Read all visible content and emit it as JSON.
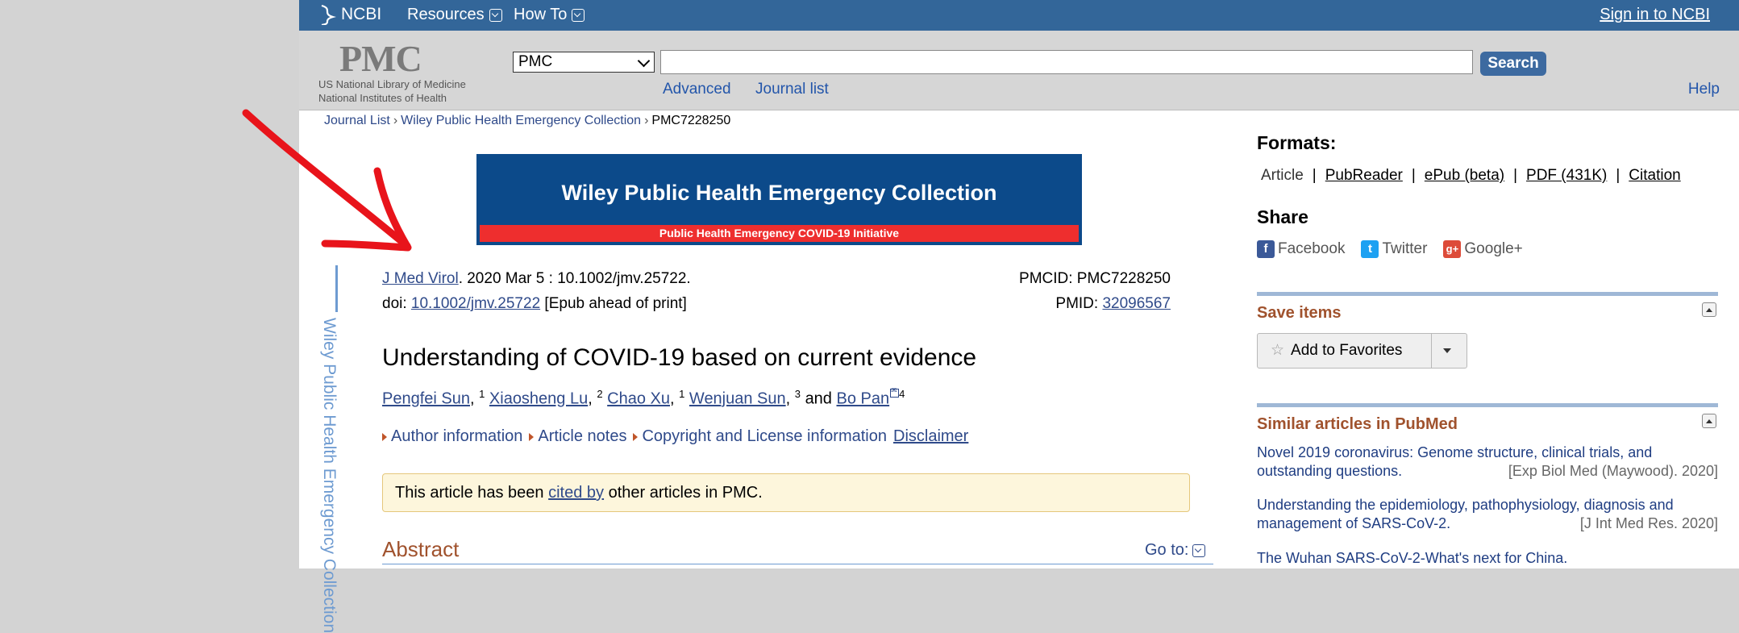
{
  "ncbi": {
    "logo": "NCBI",
    "nav": [
      {
        "label": "Resources"
      },
      {
        "label": "How To"
      }
    ],
    "signin": "Sign in to NCBI"
  },
  "pmc": {
    "logo": "PMC",
    "sub1": "US National Library of Medicine",
    "sub2": "National Institutes of Health",
    "db_selected": "PMC",
    "search_value": "",
    "search_button": "Search",
    "advanced": "Advanced",
    "journal_list": "Journal list",
    "help": "Help"
  },
  "breadcrumb": {
    "items": [
      "Journal List",
      "Wiley Public Health Emergency Collection"
    ],
    "current": "PMC7228250",
    "separator": "›"
  },
  "banner": {
    "title": "Wiley Public Health Emergency Collection",
    "strip": "Public Health Emergency COVID-19 Initiative"
  },
  "side_label": "Wiley Public Health Emergency Collection",
  "citation": {
    "journal": "J Med Virol",
    "line1_rest": ". 2020 Mar 5 : 10.1002/jmv.25722.",
    "doi_prefix": "doi: ",
    "doi": "10.1002/jmv.25722",
    "doi_suffix": " [Epub ahead of print]",
    "pmcid": "PMCID: PMC7228250",
    "pmid_label": "PMID: ",
    "pmid": "32096567"
  },
  "article": {
    "title": "Understanding of COVID-19 based on current evidence",
    "authors": [
      {
        "name": "Pengfei Sun",
        "sup": "1"
      },
      {
        "name": "Xiaosheng Lu",
        "sup": "2"
      },
      {
        "name": "Chao Xu",
        "sup": "1"
      },
      {
        "name": "Wenjuan Sun",
        "sup": "3"
      },
      {
        "name": "Bo Pan",
        "sup": "4"
      }
    ],
    "and": "and",
    "info_links": [
      "Author information",
      "Article notes",
      "Copyright and License information"
    ],
    "disclaimer": "Disclaimer",
    "cited_pre": "This article has been ",
    "cited_link": "cited by",
    "cited_post": " other articles in PMC.",
    "abstract": "Abstract",
    "goto": "Go to:"
  },
  "sidebar": {
    "formats_title": "Formats:",
    "formats": [
      "Article",
      "PubReader",
      "ePub (beta)",
      "PDF (431K)",
      "Citation"
    ],
    "share_title": "Share",
    "share": [
      {
        "label": "Facebook",
        "icon": "facebook-icon",
        "color": "#3b5998"
      },
      {
        "label": "Twitter",
        "icon": "twitter-icon",
        "color": "#1da1f2"
      },
      {
        "label": "Google+",
        "icon": "google-plus-icon",
        "color": "#dd4b39"
      }
    ],
    "save_title": "Save items",
    "add_favorites": "Add to Favorites",
    "similar_title": "Similar articles in PubMed",
    "similar": [
      {
        "title": "Novel 2019 coronavirus: Genome structure, clinical trials, and outstanding questions.",
        "source": "[Exp Biol Med (Maywood). 2020]"
      },
      {
        "title": "Understanding the epidemiology, pathophysiology, diagnosis and management of SARS-CoV-2.",
        "source": "[J Int Med Res. 2020]"
      },
      {
        "title": "The Wuhan SARS-CoV-2-What's next for China.",
        "source": ""
      }
    ]
  },
  "colors": {
    "ncbi_bar": "#336699",
    "banner": "#0c4a8a",
    "banner_strip": "#ee2e2e",
    "annotation_arrow": "#e8141b",
    "section_heading": "#a0522d"
  }
}
